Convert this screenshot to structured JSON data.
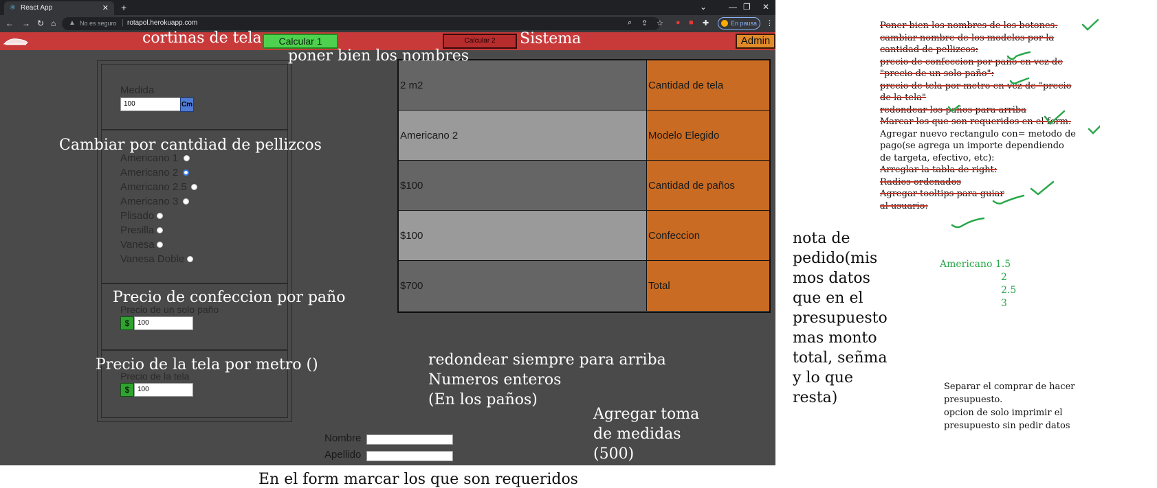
{
  "browser": {
    "tab_title": "React App",
    "tab_close": "✕",
    "new_tab": "+",
    "security_label": "No es seguro",
    "url": "rotapol.herokuapp.com",
    "pause_label": "En pausa",
    "window_controls": [
      "⌄",
      "—",
      "❐",
      "✕"
    ],
    "nav_icons": [
      "arrow-left-icon",
      "arrow-right-icon",
      "reload-icon",
      "home-icon"
    ]
  },
  "header": {
    "calc1_label": "Calcular 1",
    "calc2_label": "Calcular 2",
    "admin_label": "Admin",
    "colors": {
      "bar": "#c83a3a",
      "calc1": "#4ed14e",
      "calc2": "#b72d2d",
      "admin": "#e08a2a"
    }
  },
  "form": {
    "medida_label": "Medida",
    "medida_value": "100",
    "medida_unit": "Cm",
    "models": [
      {
        "label": "Americano 1",
        "selected": false
      },
      {
        "label": "Americano 2",
        "selected": true
      },
      {
        "label": "Americano 2.5",
        "selected": false
      },
      {
        "label": "Americano 3",
        "selected": false
      },
      {
        "label": "Plisado",
        "selected": false
      },
      {
        "label": "Presilla",
        "selected": false
      },
      {
        "label": "Vanesa",
        "selected": false
      },
      {
        "label": "Vanesa Doble",
        "selected": false
      }
    ],
    "precio_panio_label": "Precio de un solo paño",
    "precio_panio_currency": "$",
    "precio_panio_value": "100",
    "precio_tela_label": "Precio de la tela",
    "precio_tela_currency": "$",
    "precio_tela_value": "100",
    "nombre_label": "Nombre",
    "apellido_label": "Apellido"
  },
  "summary_table": {
    "rows": [
      {
        "value": "2 m2",
        "label": "Cantidad de tela"
      },
      {
        "value": "Americano 2",
        "label": "Modelo Elegido"
      },
      {
        "value": "$100",
        "label": "Cantidad de paños"
      },
      {
        "value": "$100",
        "label": "Confeccion"
      },
      {
        "value": "$700",
        "label": "Total"
      }
    ],
    "colors": {
      "dark_cell": "#656565",
      "light_cell": "#9a9a9a",
      "label_cell": "#c96b22"
    }
  },
  "annotations": {
    "cortinas": "cortinas de tela",
    "sistema": "Sistema",
    "poner_nombres": "poner bien los nombres",
    "cambiar_pellizcos": "Cambiar por cantdiad de pellizcos",
    "precio_confeccion": "Precio de confeccion  por paño",
    "precio_tela_metro": "Precio de la tela por  metro ()",
    "redondear": [
      "redondear siempre para arriba",
      "Numeros enteros",
      "(En los paños)"
    ],
    "toma_medidas": [
      "Agregar toma",
      "de medidas",
      "(500)"
    ],
    "requeridos": "En el form marcar los que son requeridos"
  },
  "notes": {
    "todo": [
      {
        "text": "Poner bien los nombres de los botones.",
        "done": true
      },
      {
        "text": "cambiar nombre de los modelos por la",
        "done": true
      },
      {
        "text": "cantidad de pellizcos:",
        "done": true
      },
      {
        "text": "precio de confeccion por paño en vez de",
        "done": true
      },
      {
        "text": "\"precio de un solo paño\":",
        "done": true
      },
      {
        "text": "precio de tela por metro en vez de \"precio",
        "done": true
      },
      {
        "text": "de la tela\"",
        "done": true
      },
      {
        "text": "redondear los paños para arriba",
        "done": true
      },
      {
        "text": "Marcar los que son requeridos en el form.",
        "done": true
      },
      {
        "text": "Agregar nuevo rectangulo con= metodo de",
        "done": false
      },
      {
        "text": "pago(se agrega un importe dependiendo",
        "done": false
      },
      {
        "text": "de targeta, efectivo, etc):",
        "done": false
      },
      {
        "text": "Arreglar la tabla de right:",
        "done": true
      },
      {
        "text": " Radios ordenados",
        "done": true
      },
      {
        "text": " Agregar tooltips para guiar",
        "done": true
      },
      {
        "text": " al usuario:",
        "done": true
      }
    ],
    "nota_pedido": [
      "nota de",
      "pedido(mis",
      "mos datos",
      "que en el",
      "presupuesto",
      "mas monto",
      "total, señma",
      "y lo que",
      "resta)"
    ],
    "americano_list": [
      "Americano 1.5",
      "2",
      "2.5",
      "3"
    ],
    "separar": [
      "Separar el comprar de hacer",
      "presupuesto.",
      "opcion de solo imprimir el",
      "presupuesto sin pedir datos"
    ]
  }
}
